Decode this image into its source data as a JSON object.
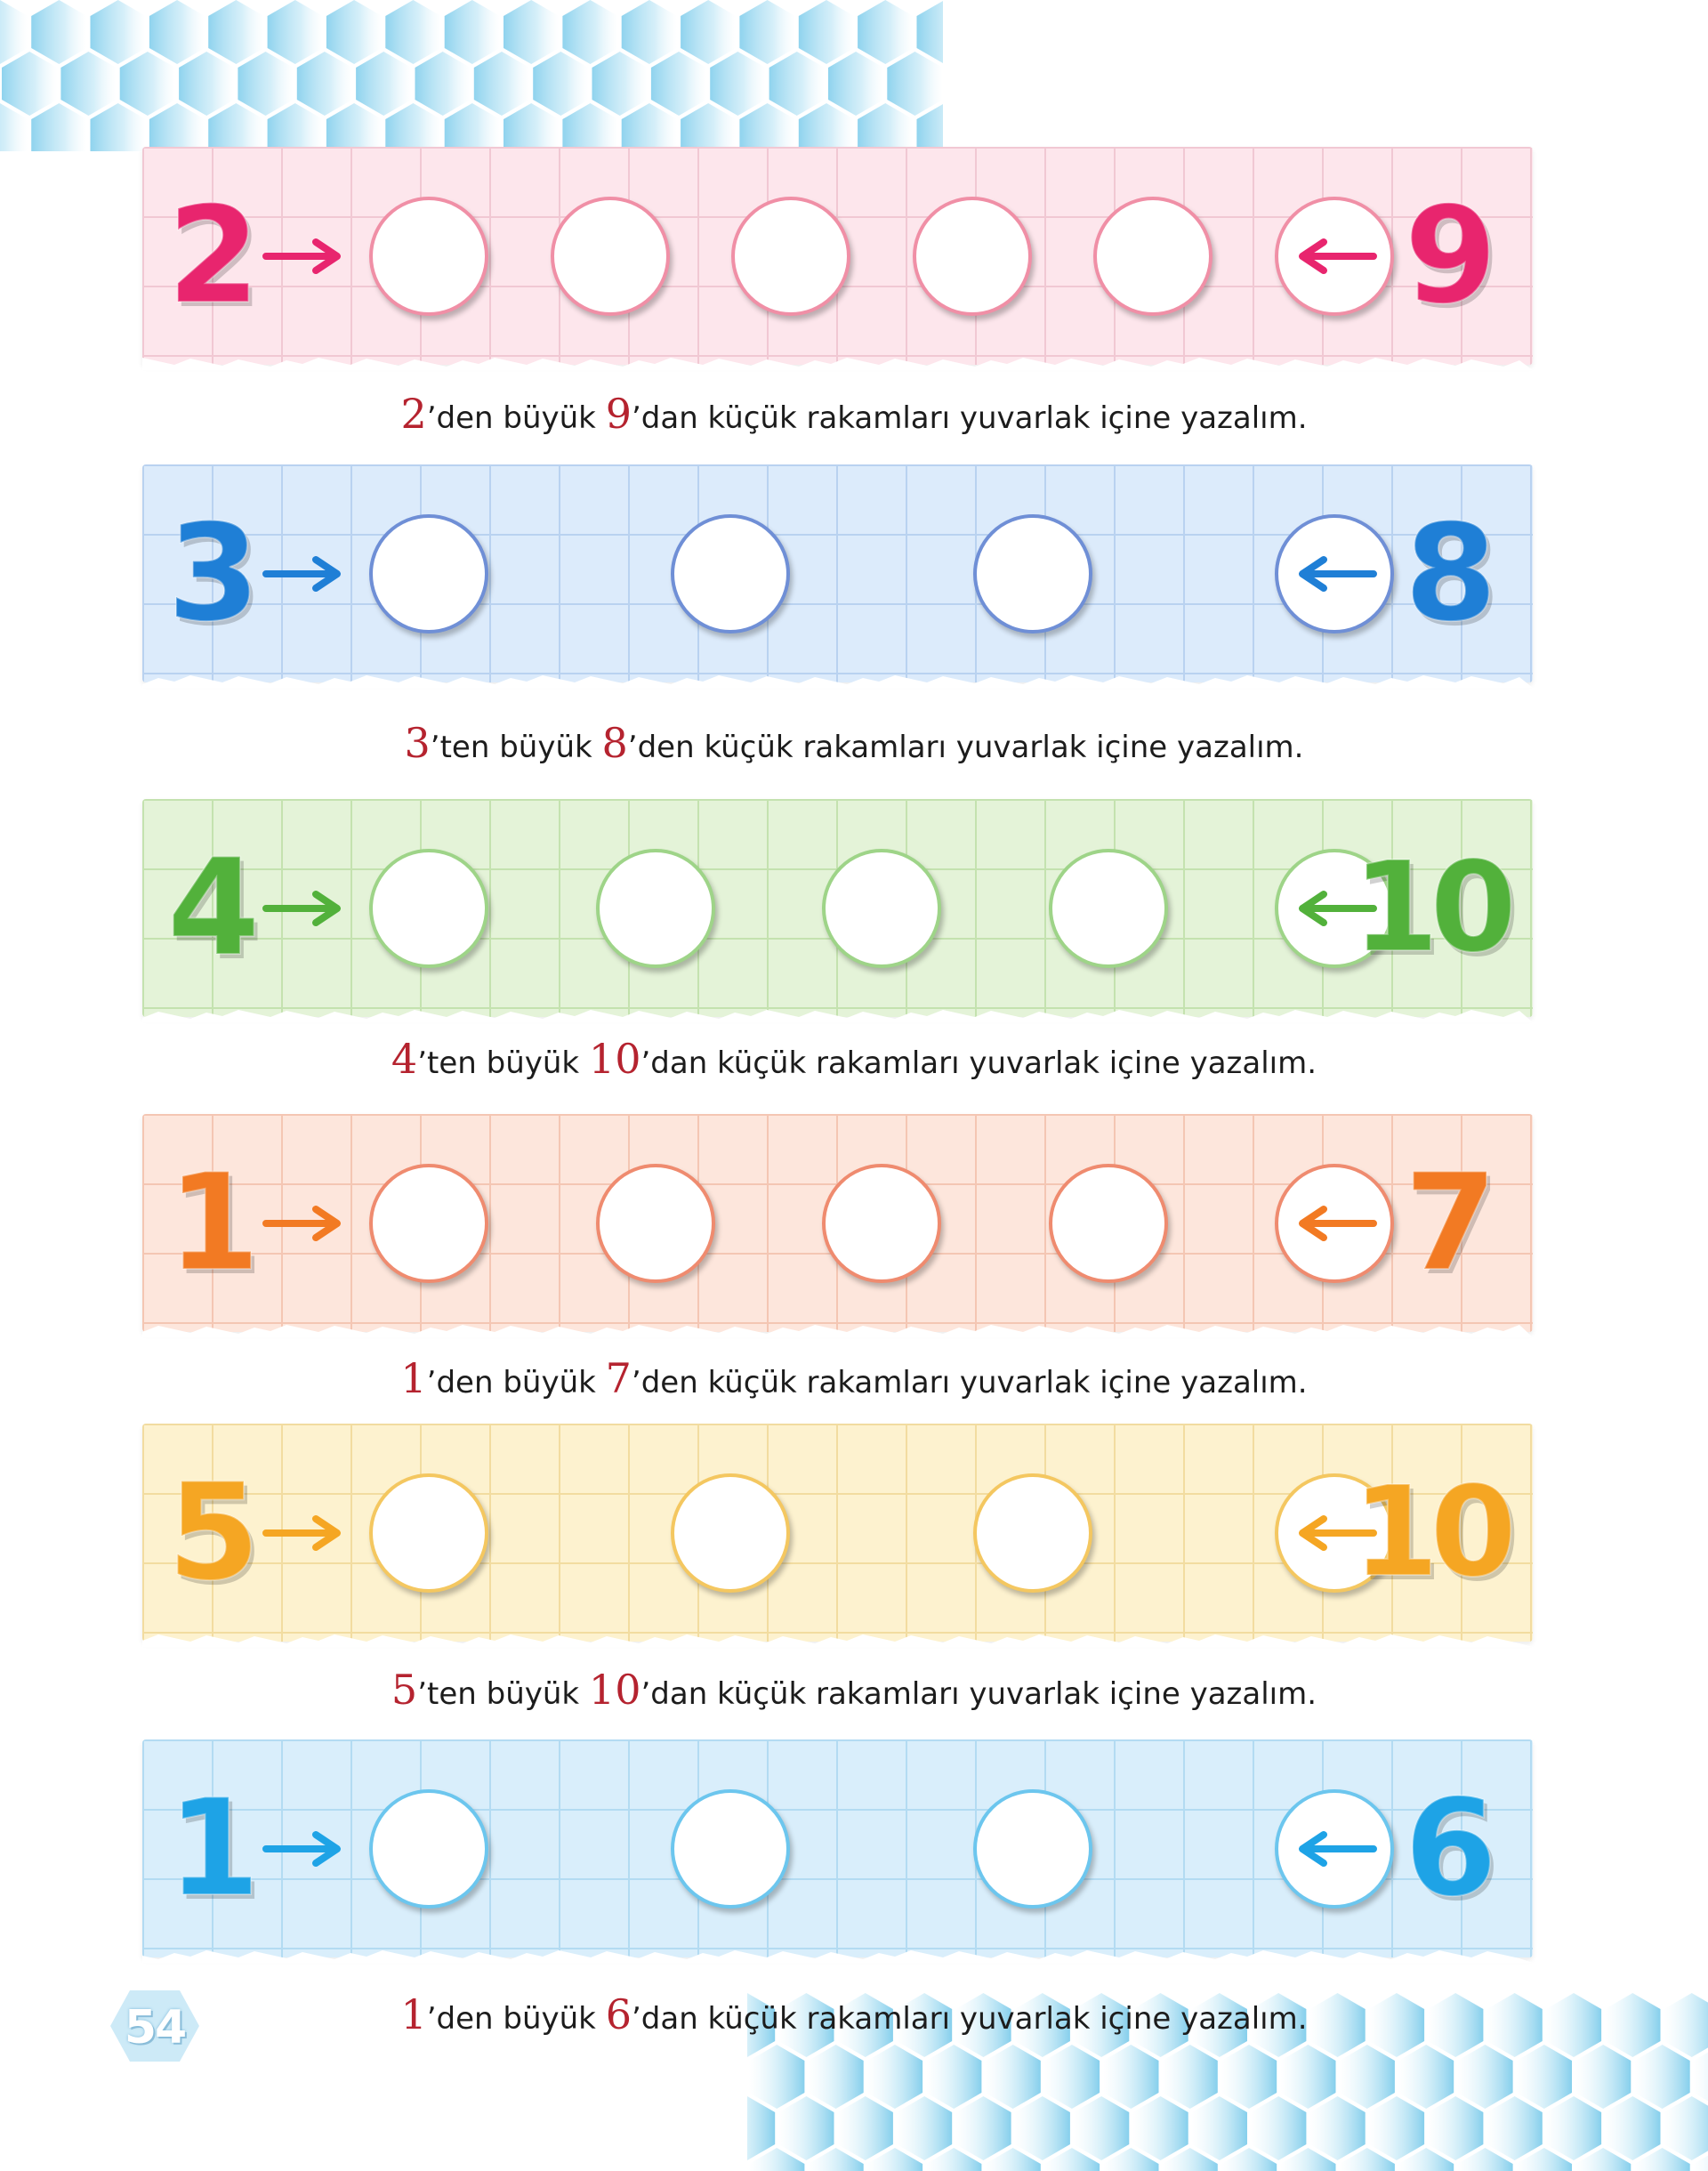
{
  "page_number": "54",
  "exercises": [
    {
      "start": "2",
      "end": "9",
      "circles": 6,
      "color": "#e8256e",
      "circle_border": "#f08fa6",
      "strip_bg": "#fde6ec",
      "grid": "#f1c8d3",
      "caption": {
        "start": "2",
        "mid": "’den büyük ",
        "end": "9",
        "rest": "’dan küçük rakamları yuvarlak içine yazalım."
      }
    },
    {
      "start": "3",
      "end": "8",
      "circles": 4,
      "color": "#1f7fd6",
      "circle_border": "#6f8fd6",
      "strip_bg": "#dcebfb",
      "grid": "#b9d2f0",
      "caption": {
        "start": "3",
        "mid": "’ten büyük  ",
        "end": "8",
        "rest": "’den küçük rakamları yuvarlak içine yazalım."
      }
    },
    {
      "start": "4",
      "end": "10",
      "circles": 5,
      "color": "#52b13b",
      "circle_border": "#9ed488",
      "strip_bg": "#e4f3d8",
      "grid": "#c4e2af",
      "caption": {
        "start": "4",
        "mid": "’ten büyük  ",
        "end": "10",
        "rest": "’dan küçük rakamları yuvarlak içine yazalım."
      }
    },
    {
      "start": "1",
      "end": "7",
      "circles": 5,
      "color": "#f27a23",
      "circle_border": "#ef8b6f",
      "strip_bg": "#fde6dc",
      "grid": "#f4c6b3",
      "caption": {
        "start": "1",
        "mid": "’den büyük ",
        "end": "7",
        "rest": "’den küçük rakamları yuvarlak içine yazalım."
      }
    },
    {
      "start": "5",
      "end": "10",
      "circles": 4,
      "color": "#f5a623",
      "circle_border": "#f4c760",
      "strip_bg": "#fdf2cf",
      "grid": "#f2dca0",
      "caption": {
        "start": "5",
        "mid": "’ten büyük  ",
        "end": "10",
        "rest": "’dan küçük rakamları yuvarlak içine yazalım."
      }
    },
    {
      "start": "1",
      "end": "6",
      "circles": 4,
      "color": "#1ea3e6",
      "circle_border": "#6cc6ee",
      "strip_bg": "#d9eefb",
      "grid": "#b3dbf2",
      "caption": {
        "start": "1",
        "mid": "’den büyük  ",
        "end": "6",
        "rest": "’dan küçük rakamları yuvarlak içine yazalım."
      }
    }
  ]
}
